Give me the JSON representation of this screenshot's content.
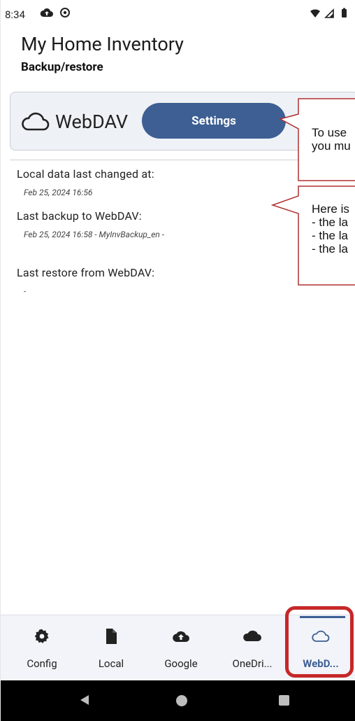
{
  "status_bar": {
    "time": "8:34"
  },
  "header": {
    "title": "My Home Inventory",
    "subtitle": "Backup/restore"
  },
  "card": {
    "service_label": "WebDAV",
    "settings_button": "Settings"
  },
  "info": {
    "local_changed_label": "Local data last changed at:",
    "local_changed_value": "Feb 25, 2024 16:56",
    "last_backup_label": "Last backup to WebDAV:",
    "last_backup_value": "Feb 25, 2024 16:58 - MyInvBackup_en -",
    "last_restore_label": "Last restore from WebDAV:",
    "last_restore_value": "-"
  },
  "callouts": {
    "settings_hint": "To use\nyou mu",
    "info_hint": "Here is\n- the la\n- the la\n- the la"
  },
  "bottom_nav": {
    "items": [
      {
        "label": "Config",
        "icon": "gear-icon"
      },
      {
        "label": "Local",
        "icon": "file-icon"
      },
      {
        "label": "Google",
        "icon": "cloud-upload-icon"
      },
      {
        "label": "OneDri...",
        "icon": "cloud-filled-icon"
      },
      {
        "label": "WebD...",
        "icon": "cloud-outline-icon"
      }
    ],
    "active_index": 4
  },
  "colors": {
    "accent": "#3d5f93",
    "callout_border": "#b03030",
    "highlight": "#c62828"
  }
}
